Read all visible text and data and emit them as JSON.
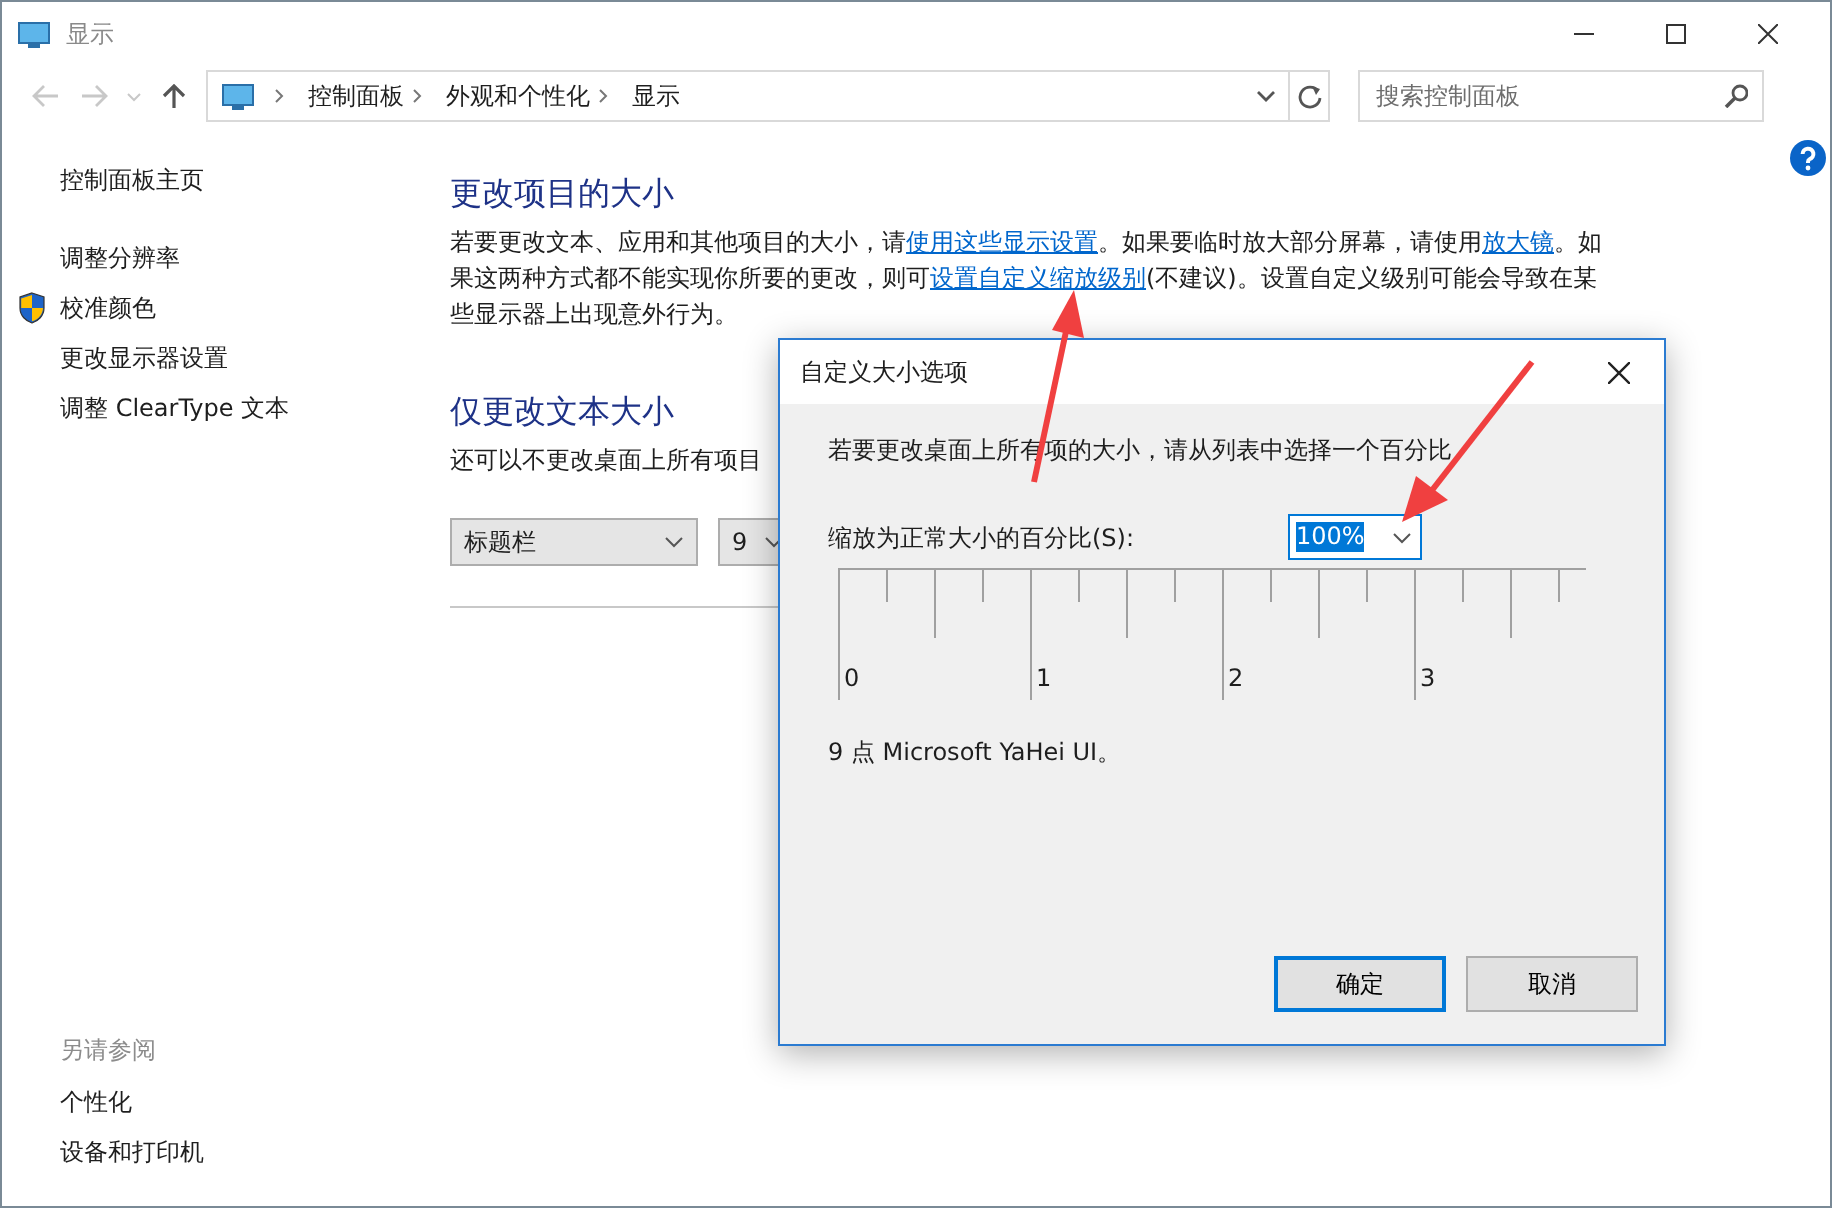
{
  "window": {
    "title": "显示"
  },
  "address_bar": {
    "breadcrumbs": [
      "控制面板",
      "外观和个性化",
      "显示"
    ]
  },
  "search": {
    "placeholder": "搜索控制面板"
  },
  "sidebar": {
    "home": "控制面板主页",
    "items": [
      {
        "label": "调整分辨率",
        "shield": false
      },
      {
        "label": "校准颜色",
        "shield": true
      },
      {
        "label": "更改显示器设置",
        "shield": false
      },
      {
        "label": "调整 ClearType 文本",
        "shield": false
      }
    ],
    "see_also_heading": "另请参阅",
    "see_also": [
      "个性化",
      "设备和打印机"
    ]
  },
  "sections": [
    {
      "heading": "更改项目的大小",
      "paragraph": [
        {
          "text": "若要更改文本、应用和其他项目的大小，请",
          "link": false
        },
        {
          "text": "使用这些显示设置",
          "link": true
        },
        {
          "text": "。如果要临时放大部分屏幕，请使用",
          "link": false
        },
        {
          "text": "放大镜",
          "link": true
        },
        {
          "text": "。如果这两种方式都不能实现你所要的更改，则可",
          "link": false
        },
        {
          "text": "设置自定义缩放级别",
          "link": true
        },
        {
          "text": "(不建议)。设置自定义级别可能会导致在某些显示器上出现意外行为。",
          "link": false
        }
      ]
    },
    {
      "heading": "仅更改文本大小",
      "paragraph": [
        {
          "text": "还可以不更改桌面上所有项目",
          "link": false
        }
      ],
      "selects": [
        "标题栏",
        "9"
      ]
    }
  ],
  "dialog": {
    "title": "自定义大小选项",
    "instruction": "若要更改桌面上所有项的大小，请从列表中选择一个百分比",
    "scale_label": "缩放为正常大小的百分比(S):",
    "scale_value": "100%",
    "ruler_labels": [
      "0",
      "1",
      "2",
      "3"
    ],
    "font_info": "9 点 Microsoft YaHei UI。",
    "buttons": [
      {
        "label": "确定",
        "default": true
      },
      {
        "label": "取消",
        "default": false
      }
    ]
  }
}
